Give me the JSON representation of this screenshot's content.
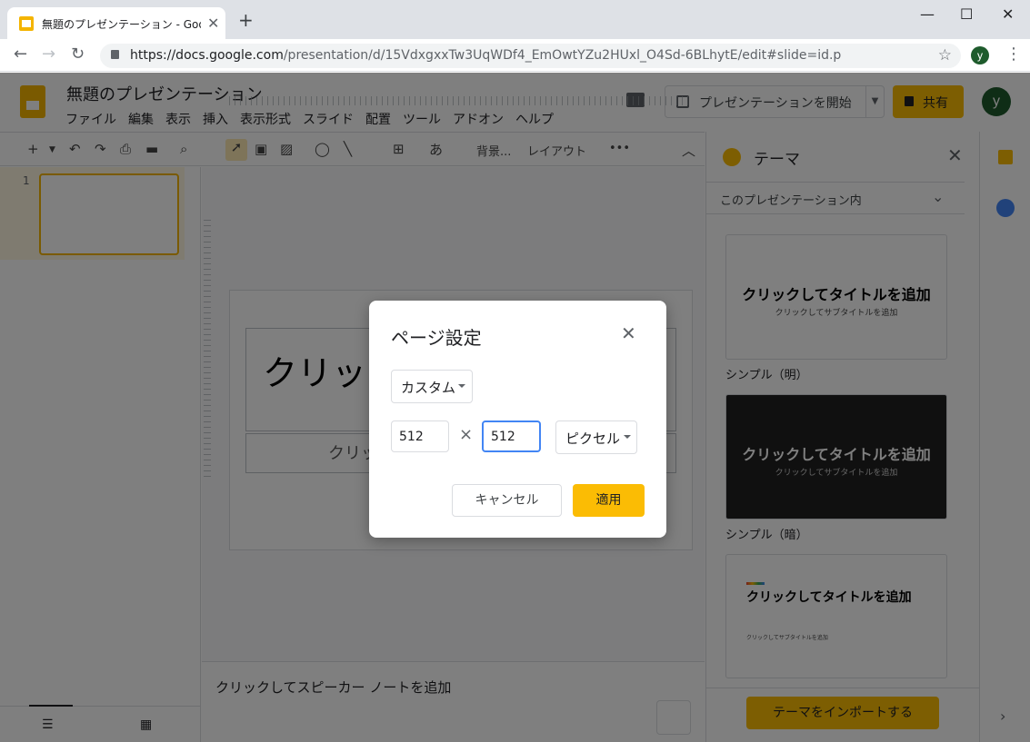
{
  "browser": {
    "tab_title": "無題のプレゼンテーション - Google ス",
    "url_host": "https://docs.google.com",
    "url_path": "/presentation/d/15VdxgxxTw3UqWDf4_EmOwtYZu2HUxl_O4Sd-6BLhytE/edit#slide=id.p",
    "profile_initial": "y",
    "window_min": "—",
    "window_max": "☐",
    "window_close": "✕",
    "new_tab": "+",
    "tab_close": "✕"
  },
  "app": {
    "doc_title": "無題のプレゼンテーション",
    "menu": [
      "ファイル",
      "編集",
      "表示",
      "挿入",
      "表示形式",
      "スライド",
      "配置",
      "ツール",
      "アドオン",
      "ヘルプ"
    ],
    "present_label": "プレゼンテーションを開始",
    "share_label": "共有",
    "user_initial": "y",
    "toolbar": {
      "text_style": "あ",
      "background": "背景...",
      "layout": "レイアウト",
      "more": "•••"
    }
  },
  "filmstrip": {
    "slide_number": "1"
  },
  "slide": {
    "title_text": "クリック",
    "subtitle_text": "クリッ"
  },
  "notes": {
    "placeholder": "クリックしてスピーカー ノートを追加"
  },
  "theme_panel": {
    "title": "テーマ",
    "section": "このプレゼンテーション内",
    "themes": [
      {
        "name": "シンプル（明）",
        "title": "クリックしてタイトルを追加",
        "subtitle": "クリックしてサブタイトルを追加"
      },
      {
        "name": "シンプル（暗）",
        "title": "クリックしてタイトルを追加",
        "subtitle": "クリックしてサブタイトルを追加"
      },
      {
        "name": "",
        "title": "クリックしてタイトルを追加",
        "subtitle": "クリックしてサブタイトルを追加"
      }
    ],
    "import_label": "テーマをインポートする"
  },
  "dialog": {
    "title": "ページ設定",
    "preset": "カスタム",
    "width": "512",
    "height": "512",
    "times": "×",
    "unit": "ピクセル",
    "cancel_label": "キャンセル",
    "apply_label": "適用"
  },
  "colors": {
    "accent": "#fbbc04",
    "focus": "#4285f4"
  }
}
